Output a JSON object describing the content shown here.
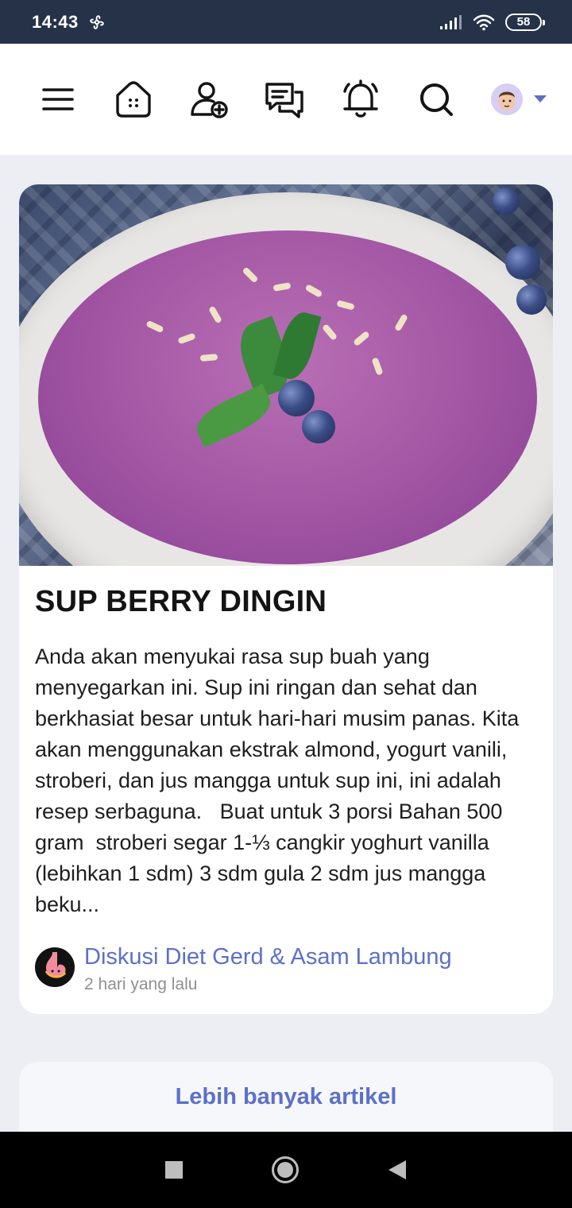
{
  "status_bar": {
    "time": "14:43",
    "battery": "58"
  },
  "top_nav": {
    "icons": [
      "menu-icon",
      "home-icon",
      "add-friend-icon",
      "chat-icon",
      "bell-icon",
      "search-icon",
      "avatar",
      "chevron-down-icon"
    ],
    "accent_color": "#5c70c9"
  },
  "article": {
    "title": "SUP BERRY DINGIN",
    "excerpt": "Anda akan menyukai rasa sup buah yang menyegarkan ini. Sup ini ringan dan sehat dan berkhasiat besar untuk hari-hari musim panas. Kita akan menggunakan ekstrak almond, yogurt vanili, stroberi, dan jus mangga untuk sup ini, ini adalah resep serbaguna.   Buat untuk 3 porsi Bahan 500 gram  stroberi segar 1-⅓ cangkir yoghurt vanilla (lebihkan 1 sdm) 3 sdm gula 2 sdm jus mangga beku...",
    "source_name": "Diskusi Diet Gerd & Asam Lambung",
    "time_ago": "2 hari yang lalu"
  },
  "more_button": {
    "label": "Lebih banyak artikel"
  }
}
